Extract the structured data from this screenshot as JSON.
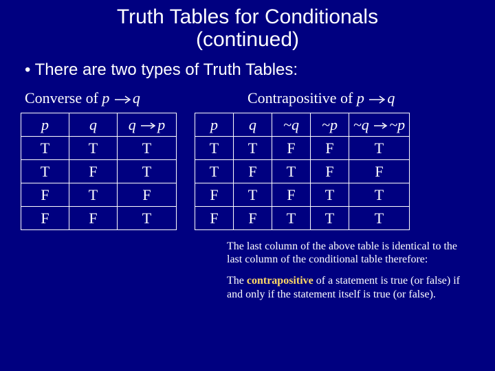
{
  "title_line1": "Truth Tables for Conditionals",
  "title_line2": "(continued)",
  "bullet": "•  There are two types of Truth Tables:",
  "label_left_pre": "Converse of ",
  "label_left_p": "p",
  "label_left_q": "q",
  "label_right_pre": "Contrapositive of ",
  "label_right_p": "p",
  "label_right_q": "q",
  "tl": {
    "h_p": "p",
    "h_q": "q",
    "h_qa": "q",
    "h_pb": "p",
    "r1": [
      "T",
      "T",
      "T"
    ],
    "r2": [
      "T",
      "F",
      "T"
    ],
    "r3": [
      "F",
      "T",
      "F"
    ],
    "r4": [
      "F",
      "F",
      "T"
    ]
  },
  "tr": {
    "h_p": "p",
    "h_q": "q",
    "h_nq": "~q",
    "h_np": "~p",
    "h_la": "~q",
    "h_lb": "~p",
    "r1": [
      "T",
      "T",
      "F",
      "F",
      "T"
    ],
    "r2": [
      "T",
      "F",
      "T",
      "F",
      "F"
    ],
    "r3": [
      "F",
      "T",
      "F",
      "T",
      "T"
    ],
    "r4": [
      "F",
      "F",
      "T",
      "T",
      "T"
    ]
  },
  "note1": "The last column of the above table is identical to the last column of the conditional table therefore:",
  "note2a": "The ",
  "note2c": "contrapositive",
  "note2b": " of a statement is true (or false) if and only if the statement itself is true (or false)."
}
